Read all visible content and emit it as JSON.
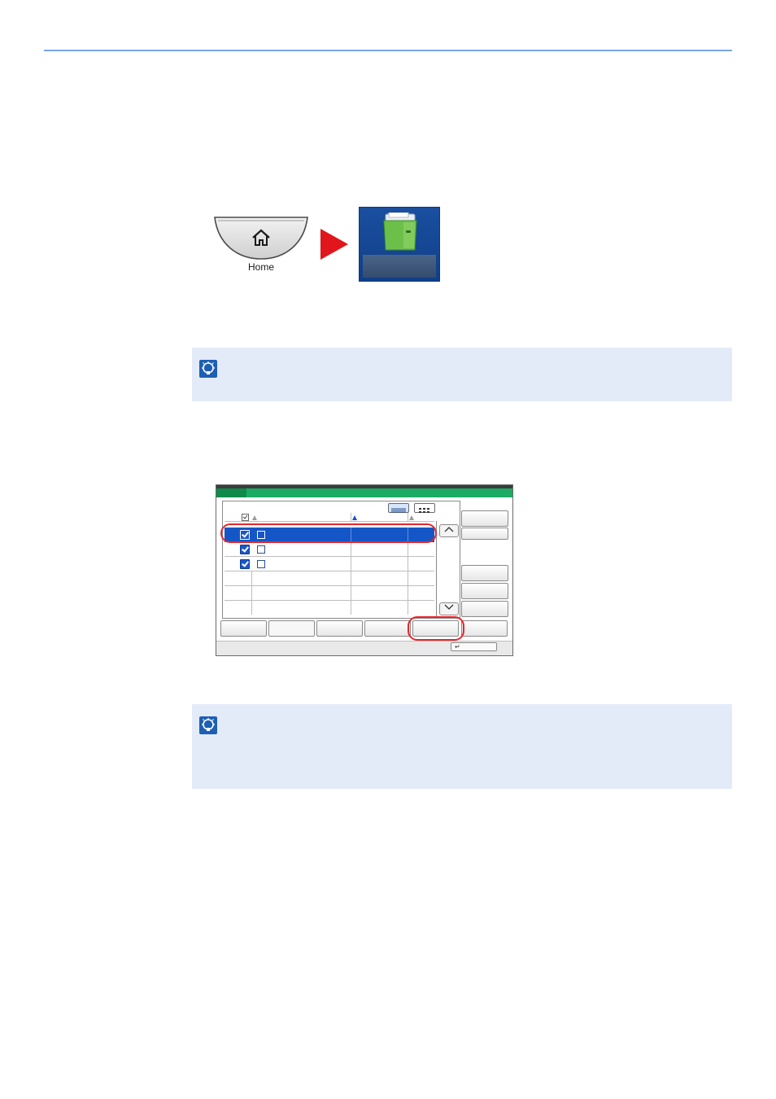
{
  "home_key": {
    "label": "Home",
    "icon": "house-icon"
  },
  "flow_arrow": {
    "icon": "arrow-right-icon",
    "color": "#e0161c"
  },
  "box_tile": {
    "icon": "document-box-icon"
  },
  "notes": [
    {
      "icon": "note-icon"
    },
    {
      "icon": "note-icon"
    }
  ],
  "panel": {
    "list": {
      "rows": [
        {
          "selected": true,
          "checked": true
        },
        {
          "selected": false,
          "checked": true
        },
        {
          "selected": false,
          "checked": true
        },
        {
          "selected": false,
          "checked": false
        },
        {
          "selected": false,
          "checked": false
        },
        {
          "selected": false,
          "checked": false
        }
      ]
    },
    "scroll": {
      "up_icon": "chevron-up-icon",
      "down_icon": "chevron-down-icon"
    },
    "enter_icon": "enter-icon",
    "enter_symbol": "↵"
  },
  "colors": {
    "accent_green": "#1bab64",
    "selection_blue": "#1556c7",
    "highlight_red": "#e8252b",
    "note_bg": "#e4ebf8",
    "rule_blue": "#7aa6e6"
  }
}
